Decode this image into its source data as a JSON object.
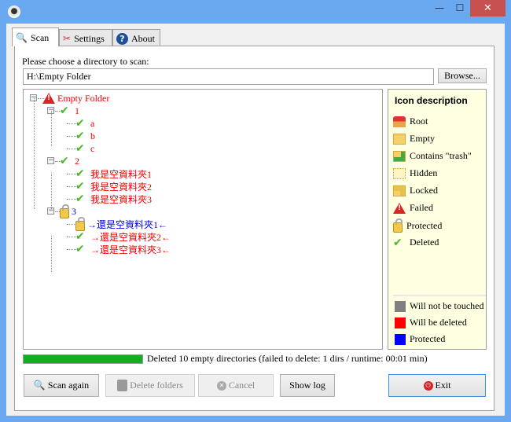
{
  "window": {
    "close": "✕",
    "minimize": "—",
    "maximize": "☐"
  },
  "tabs": [
    {
      "label": "Scan",
      "icon": "magnifier-icon"
    },
    {
      "label": "Settings",
      "icon": "tools-icon"
    },
    {
      "label": "About",
      "icon": "help-icon"
    }
  ],
  "scan": {
    "prompt": "Please choose a directory to scan:",
    "directory": "H:\\Empty Folder",
    "browse": "Browse..."
  },
  "tree": [
    {
      "label": "Empty Folder",
      "level": 0,
      "icon": "failed",
      "color": "red"
    },
    {
      "label": "1",
      "level": 1,
      "icon": "deleted",
      "color": "red"
    },
    {
      "label": "a",
      "level": 2,
      "icon": "deleted",
      "color": "red"
    },
    {
      "label": "b",
      "level": 2,
      "icon": "deleted",
      "color": "red"
    },
    {
      "label": "c",
      "level": 2,
      "icon": "deleted",
      "color": "red"
    },
    {
      "label": "2",
      "level": 1,
      "icon": "deleted",
      "color": "red"
    },
    {
      "label": "我是空資料夾1",
      "level": 2,
      "icon": "deleted",
      "color": "red"
    },
    {
      "label": "我是空資料夾2",
      "level": 2,
      "icon": "deleted",
      "color": "red"
    },
    {
      "label": "我是空資料夾3",
      "level": 2,
      "icon": "deleted",
      "color": "red"
    },
    {
      "label": "3",
      "level": 1,
      "icon": "protected",
      "color": "blue"
    },
    {
      "label": "→還是空資料夾1←",
      "level": 2,
      "icon": "protected",
      "color": "blue"
    },
    {
      "label": "→還是空資料夾2←",
      "level": 2,
      "icon": "deleted",
      "color": "red"
    },
    {
      "label": "→還是空資料夾3←",
      "level": 2,
      "icon": "deleted",
      "color": "red"
    }
  ],
  "legend": {
    "title": "Icon description",
    "icons": [
      {
        "label": "Root",
        "icon": "home-icon"
      },
      {
        "label": "Empty",
        "icon": "folder-icon"
      },
      {
        "label": "Contains \"trash\"",
        "icon": "folder-trash-icon"
      },
      {
        "label": "Hidden",
        "icon": "hidden-folder-icon"
      },
      {
        "label": "Locked",
        "icon": "locked-folder-icon"
      },
      {
        "label": "Failed",
        "icon": "warning-icon"
      },
      {
        "label": "Protected",
        "icon": "lock-icon"
      },
      {
        "label": "Deleted",
        "icon": "check-icon"
      }
    ],
    "colors": [
      {
        "label": "Will not be touched",
        "color": "#808080"
      },
      {
        "label": "Will be deleted",
        "color": "#ff0000"
      },
      {
        "label": "Protected",
        "color": "#0000ff"
      }
    ]
  },
  "progress": {
    "percent": 100,
    "color": "#0fae25"
  },
  "status": "Deleted 10 empty directories (failed to delete: 1 dirs / runtime: 00:01 min)",
  "buttons": {
    "scan_again": "Scan again",
    "delete_folders": "Delete folders",
    "cancel": "Cancel",
    "show_log": "Show log",
    "exit": "Exit"
  }
}
